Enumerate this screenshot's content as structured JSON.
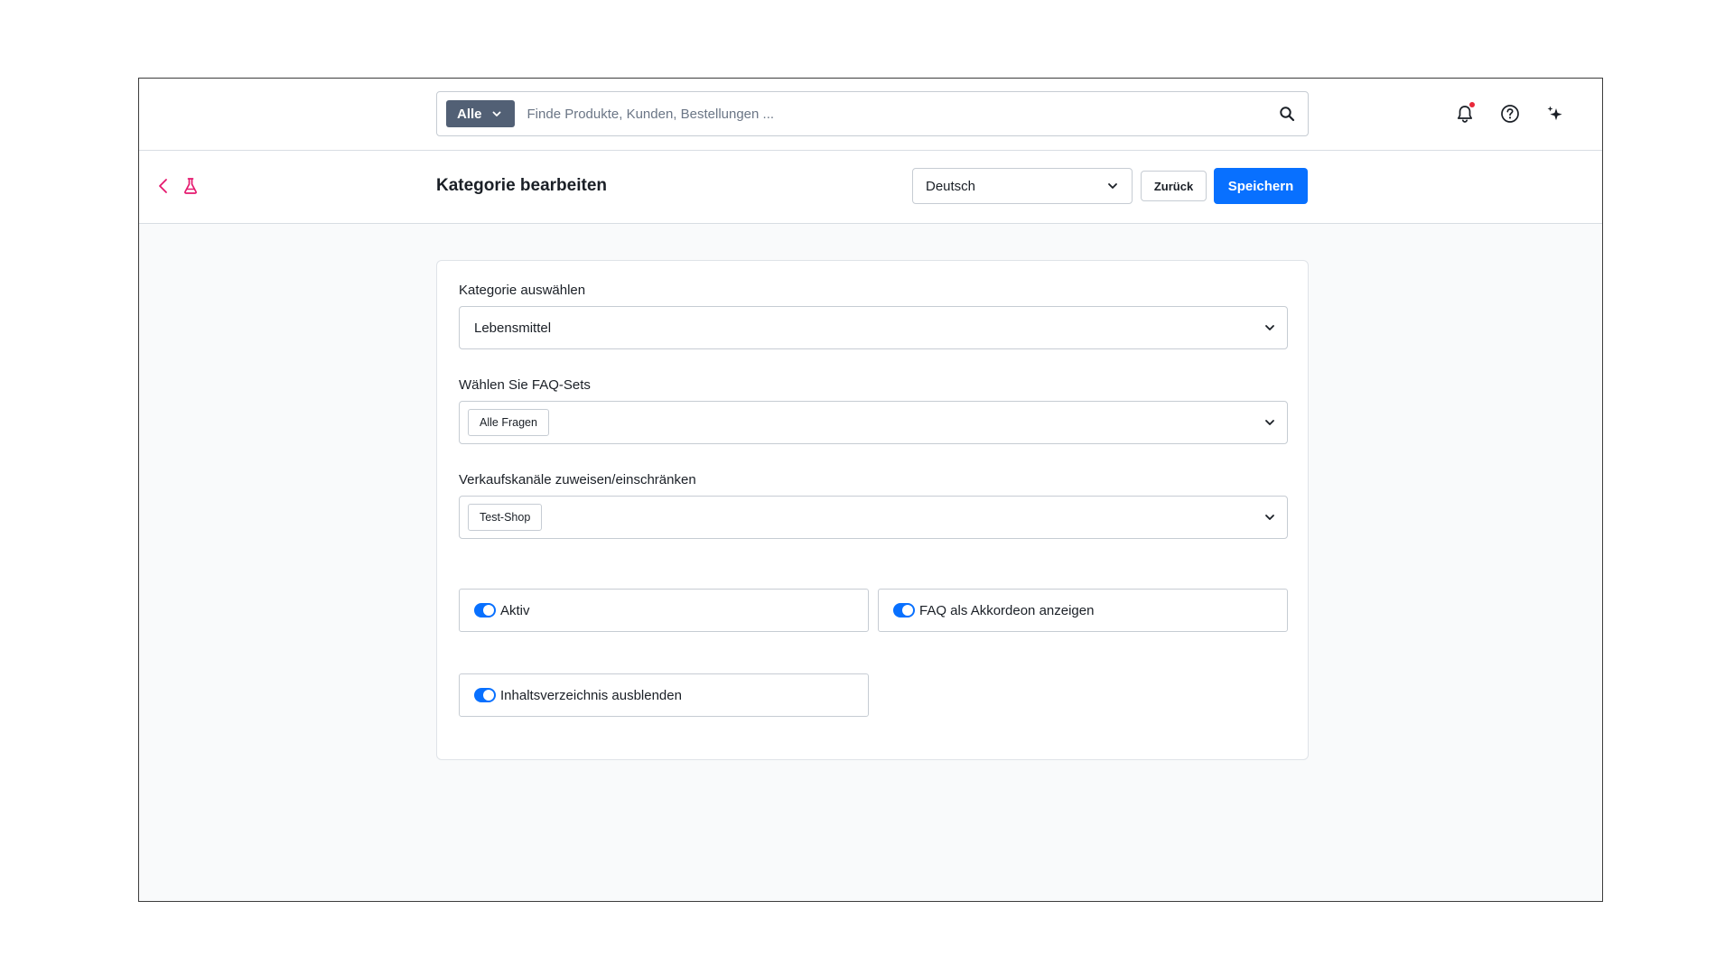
{
  "search": {
    "scope_label": "Alle",
    "placeholder": "Finde Produkte, Kunden, Bestellungen ..."
  },
  "header": {
    "title": "Kategorie bearbeiten",
    "language": "Deutsch",
    "back_label": "Zurück",
    "save_label": "Speichern"
  },
  "form": {
    "category": {
      "label": "Kategorie auswählen",
      "value": "Lebensmittel"
    },
    "faq_sets": {
      "label": "Wählen Sie FAQ-Sets",
      "tags": [
        "Alle Fragen"
      ]
    },
    "sales_channels": {
      "label": "Verkaufskanäle zuweisen/einschränken",
      "tags": [
        "Test-Shop"
      ]
    },
    "toggles": {
      "active": {
        "label": "Aktiv",
        "on": true
      },
      "faq_accordion": {
        "label": "FAQ als Akkordeon anzeigen",
        "on": true
      },
      "hide_toc": {
        "label": "Inhaltsverzeichnis ausblenden",
        "on": true
      }
    }
  },
  "colors": {
    "accent": "#0870ff",
    "scope_bg": "#526075",
    "brand_pink": "#e5186e",
    "notification_dot": "#e8283a"
  },
  "icons": [
    "search-icon",
    "bell-icon",
    "help-icon",
    "sparkles-icon",
    "chevron-left-icon",
    "flask-icon",
    "chevron-down-icon"
  ]
}
